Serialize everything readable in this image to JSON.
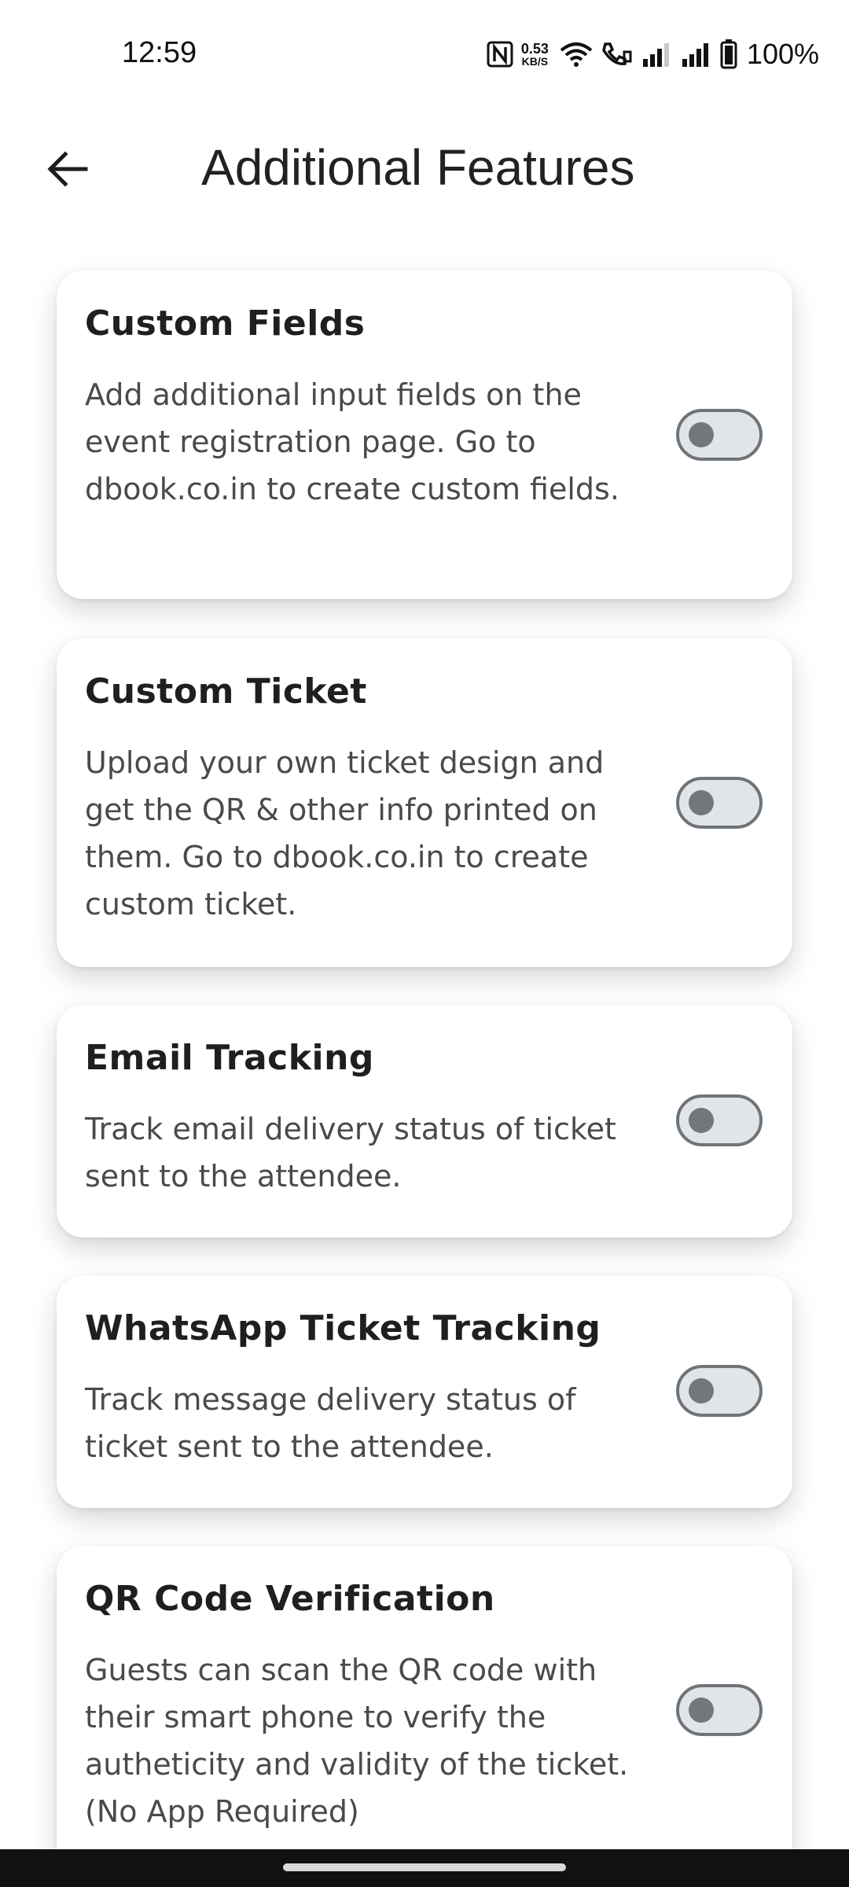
{
  "status_bar": {
    "time": "12:59",
    "net_speed_value": "0.53",
    "net_speed_unit": "KB/S",
    "battery": "100%",
    "icons": [
      "nfc-icon",
      "wifi-icon",
      "wifi-calling-icon",
      "signal-icon",
      "signal-icon",
      "battery-icon"
    ]
  },
  "app_bar": {
    "title": "Additional Features",
    "back_icon": "arrow-left-icon"
  },
  "features": [
    {
      "title": "Custom Fields",
      "description": "Add additional input fields on the event registration page. Go to dbook.co.in to create custom fields.",
      "enabled": false
    },
    {
      "title": "Custom Ticket",
      "description": "Upload your own ticket design and get the QR & other info printed on them. Go to dbook.co.in to create custom ticket.",
      "enabled": false
    },
    {
      "title": "Email Tracking",
      "description": "Track email delivery status of ticket sent to the attendee.",
      "enabled": false
    },
    {
      "title": "WhatsApp Ticket Tracking",
      "description": "Track message delivery status of ticket sent to the attendee.",
      "enabled": false
    },
    {
      "title": "QR Code Verification",
      "description": "Guests can scan the QR code with their smart phone to verify the autheticity and validity of the ticket. (No App Required)",
      "enabled": false
    }
  ],
  "colors": {
    "toggle_track": "#e2e5e8",
    "toggle_border": "#6f7479",
    "toggle_knob": "#72777b",
    "card_bg": "#ffffff",
    "nav_bar": "#111111"
  }
}
